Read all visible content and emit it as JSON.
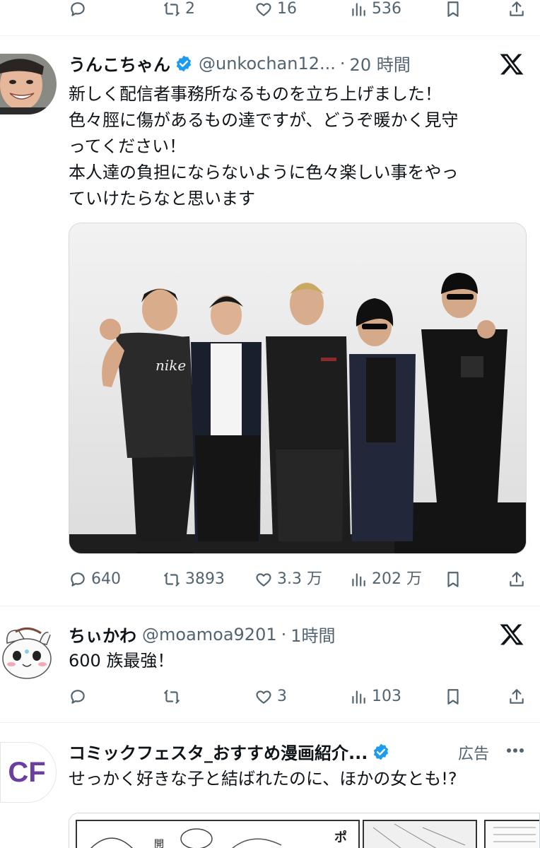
{
  "top_actions": {
    "reply_count": "",
    "retweet_count": "2",
    "like_count": "16",
    "view_count": "536"
  },
  "tweet1": {
    "display_name": "うんこちゃん",
    "handle": "@unkochan12...",
    "separator": "·",
    "time": "20 時間",
    "text": "新しく配信者事務所なるものを立ち上げました！\n色々脛に傷があるもの達ですが、どうぞ暖かく見守\nってください！\n本人達の負担にならないように色々楽しい事をやっ\nていけたらなと思います",
    "shirt_text": "nike",
    "actions": {
      "reply_count": "640",
      "retweet_count": "3893",
      "like_count": "3.3 万",
      "view_count": "202 万"
    }
  },
  "tweet2": {
    "display_name": "ちぃかわ",
    "handle": "@moamoa9201",
    "separator": "·",
    "time": "1時間",
    "text": "600 族最強！",
    "actions": {
      "reply_count": "",
      "retweet_count": "",
      "like_count": "3",
      "view_count": "103"
    }
  },
  "tweet3": {
    "avatar_text": "CF",
    "display_name": "コミックフェスタ_おすすめ漫画紹介...",
    "ad_label": "広告",
    "text": "せっかく好きな子と結ばれたのに、ほかの女とも!?",
    "comic_text_1": "開",
    "comic_text_2": "ポ"
  },
  "colors": {
    "text_primary": "#0f1419",
    "text_secondary": "#536471",
    "verified_blue": "#1d9bf0",
    "divider": "#eff3f4",
    "cf_purple": "#6b3fa0"
  }
}
